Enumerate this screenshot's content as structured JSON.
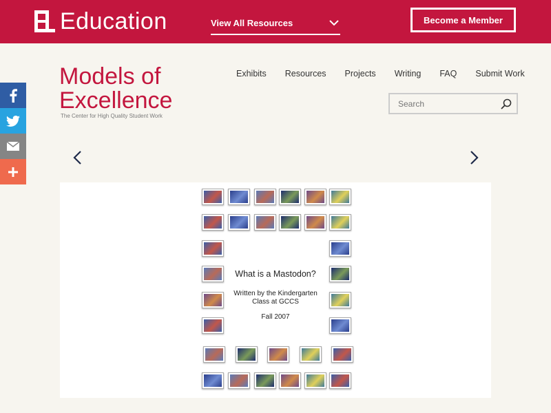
{
  "header": {
    "logo_text": "Education",
    "resources_label": "View All Resources",
    "member_button": "Become a Member"
  },
  "social": {
    "facebook_icon": "facebook-icon",
    "twitter_icon": "twitter-icon",
    "email_icon": "email-icon",
    "share_icon": "plus-icon"
  },
  "brand": {
    "line1": "Models of",
    "line2": "Excellence",
    "tagline": "The Center for High Quality Student Work"
  },
  "nav": [
    "Exhibits",
    "Resources",
    "Projects",
    "Writing",
    "FAQ",
    "Submit Work"
  ],
  "search": {
    "placeholder": "Search"
  },
  "slide": {
    "title": "What is a Mastodon?",
    "line1": "Written by the Kindergarten",
    "line2": "Class at GCCS",
    "date": "Fall 2007"
  },
  "colors": {
    "brand": "#c3163e",
    "facebook": "#2f5da4",
    "twitter": "#28a3e0",
    "email": "#858585",
    "share": "#ef6a4d"
  }
}
